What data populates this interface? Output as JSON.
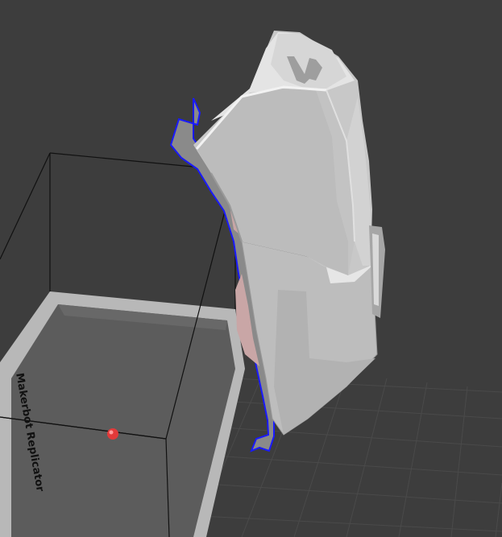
{
  "viewport": {
    "background_color": "#3d3d3d"
  },
  "build_volume": {
    "plate_label": "Makerbot Replicator",
    "plate_color": "#5c5c5c",
    "frame_color": "#b8b8b8",
    "line_color": "#111111"
  },
  "origin_marker": {
    "color": "#e23a3a"
  },
  "model": {
    "body_color": "#c8c8c8",
    "edge_color": "#f2f2f2",
    "shadow_color": "#8e8e8e",
    "overhang_outline_color": "#1a1aff",
    "overhang_fill_color": "#c9a6a6"
  }
}
